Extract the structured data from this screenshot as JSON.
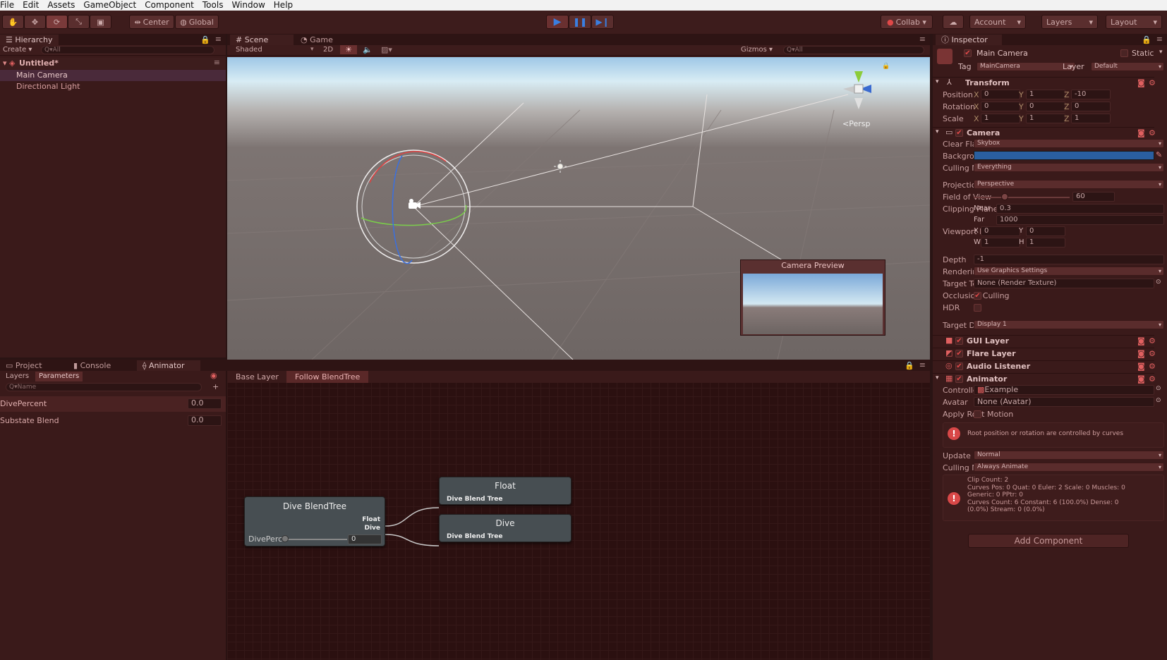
{
  "menu": [
    "File",
    "Edit",
    "Assets",
    "GameObject",
    "Component",
    "Tools",
    "Window",
    "Help"
  ],
  "toolbar": {
    "pivot": "Center",
    "space": "Global",
    "collab": "Collab",
    "account": "Account",
    "layers": "Layers",
    "layout": "Layout",
    "tools": [
      "hand-icon",
      "move-icon",
      "rotate-icon",
      "scale-icon",
      "rect-tool-icon"
    ],
    "play_icons": [
      "play-icon",
      "pause-icon",
      "step-icon"
    ]
  },
  "hierarchy": {
    "tab": "Hierarchy",
    "create": "Create",
    "search": "Q▾All",
    "scene": "Untitled*",
    "items": [
      "Main Camera",
      "Directional Light"
    ]
  },
  "scene": {
    "tabs": [
      "Scene",
      "Game"
    ],
    "shading": "Shaded",
    "mode2d": "2D",
    "gizmos": "Gizmos",
    "search": "Q▾All",
    "persp": "<Persp",
    "preview_title": "Camera Preview"
  },
  "bottom": {
    "tabs": [
      "Project",
      "Console",
      "Animator"
    ],
    "subtabs": [
      "Layers",
      "Parameters"
    ],
    "search": "Q▾Name",
    "params": [
      {
        "name": "DivePercent",
        "value": "0.0"
      },
      {
        "name": "Substate Blend",
        "value": "0.0"
      }
    ],
    "breadcrumb": [
      "Base Layer",
      "Follow BlendTree"
    ]
  },
  "graph": {
    "blend": {
      "title": "Dive BlendTree",
      "outs": [
        "Float",
        "Dive"
      ],
      "param": "DivePerc",
      "value": "0"
    },
    "nodes": [
      {
        "title": "Float",
        "sub": "Dive Blend Tree"
      },
      {
        "title": "Dive",
        "sub": "Dive Blend Tree"
      }
    ]
  },
  "inspector": {
    "tab": "Inspector",
    "object": "Main Camera",
    "static": "Static",
    "tag_label": "Tag",
    "tag": "MainCamera",
    "layer_label": "Layer",
    "layer": "Default",
    "transform": {
      "title": "Transform",
      "rows": [
        {
          "label": "Position",
          "x": "0",
          "y": "1",
          "z": "-10"
        },
        {
          "label": "Rotation",
          "x": "0",
          "y": "0",
          "z": "0"
        },
        {
          "label": "Scale",
          "x": "1",
          "y": "1",
          "z": "1"
        }
      ]
    },
    "camera": {
      "title": "Camera",
      "clear_flags": {
        "label": "Clear Flags",
        "value": "Skybox"
      },
      "background": {
        "label": "Background",
        "color": "#2a5fa0"
      },
      "culling": {
        "label": "Culling Mask",
        "value": "Everything"
      },
      "projection": {
        "label": "Projection",
        "value": "Perspective"
      },
      "fov": {
        "label": "Field of View",
        "value": "60",
        "fraction": 0.3
      },
      "clip": {
        "label": "Clipping Planes",
        "near_label": "Near",
        "near": "0.3",
        "far_label": "Far",
        "far": "1000"
      },
      "viewport": {
        "label": "Viewport Rect",
        "x": "0",
        "y": "0",
        "w": "1",
        "h": "1"
      },
      "depth": {
        "label": "Depth",
        "value": "-1"
      },
      "rpath": {
        "label": "Rendering Path",
        "value": "Use Graphics Settings"
      },
      "target_tex": {
        "label": "Target Texture",
        "value": "None (Render Texture)"
      },
      "occlusion": {
        "label": "Occlusion Culling",
        "checked": true
      },
      "hdr": {
        "label": "HDR",
        "checked": false
      },
      "target_display": {
        "label": "Target Display",
        "value": "Display 1"
      }
    },
    "gui_layer": "GUI Layer",
    "flare_layer": "Flare Layer",
    "audio_listener": "Audio Listener",
    "animator": {
      "title": "Animator",
      "controller": {
        "label": "Controller",
        "value": "Example"
      },
      "avatar": {
        "label": "Avatar",
        "value": "None (Avatar)"
      },
      "root_motion": {
        "label": "Apply Root Motion",
        "checked": false
      },
      "warning": "Root position or rotation are controlled by curves",
      "update": {
        "label": "Update Mode",
        "value": "Normal"
      },
      "culling": {
        "label": "Culling Mode",
        "value": "Always Animate"
      },
      "info": [
        "Clip Count: 2",
        "Curves Pos: 0 Quat: 0 Euler: 2 Scale: 0 Muscles: 0",
        "Generic: 0 PPtr: 0",
        "Curves Count: 6 Constant: 6 (100.0%) Dense: 0",
        "(0.0%) Stream: 0 (0.0%)"
      ]
    },
    "add_component": "Add Component"
  },
  "colors": {
    "accent": "#e04848",
    "panel": "#3a1a1a",
    "toolbar": "#3d1c1c"
  }
}
